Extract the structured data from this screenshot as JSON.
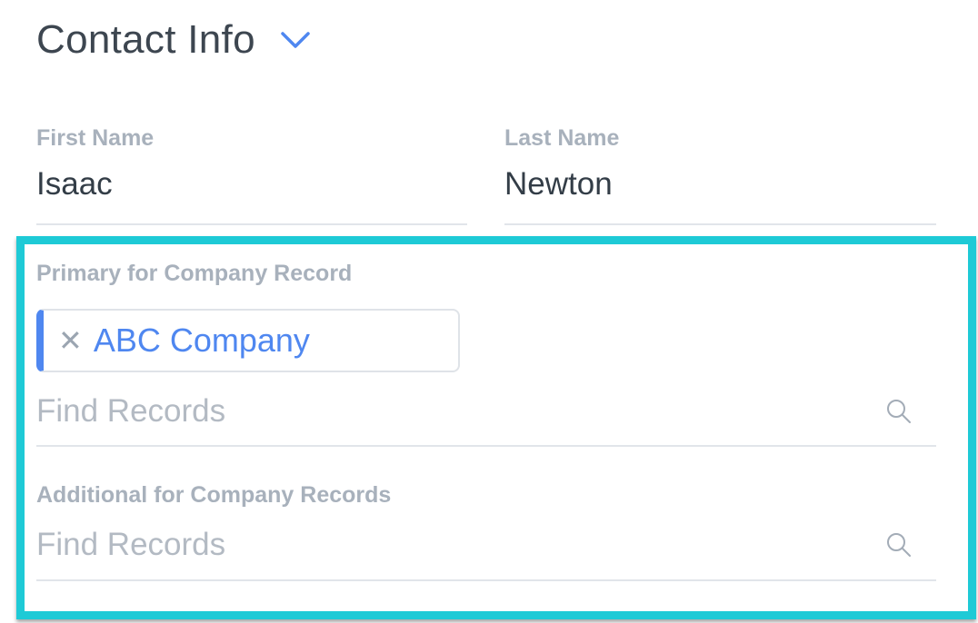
{
  "section": {
    "title": "Contact Info",
    "toggle_icon": "chevron-down-icon"
  },
  "fields": {
    "first_name": {
      "label": "First Name",
      "value": "Isaac"
    },
    "last_name": {
      "label": "Last Name",
      "value": "Newton"
    }
  },
  "primary_company": {
    "label": "Primary for Company Record",
    "selected_tag": "ABC Company",
    "remove_icon": "close-icon",
    "search": {
      "placeholder": "Find Records",
      "value": "",
      "icon": "search-icon"
    }
  },
  "additional_companies": {
    "label": "Additional for Company Records",
    "search": {
      "placeholder": "Find Records",
      "value": "",
      "icon": "search-icon"
    }
  },
  "colors": {
    "accent": "#4f87f0",
    "highlight": "#1ecad6",
    "label": "#a8b1bc",
    "text": "#333d47"
  }
}
